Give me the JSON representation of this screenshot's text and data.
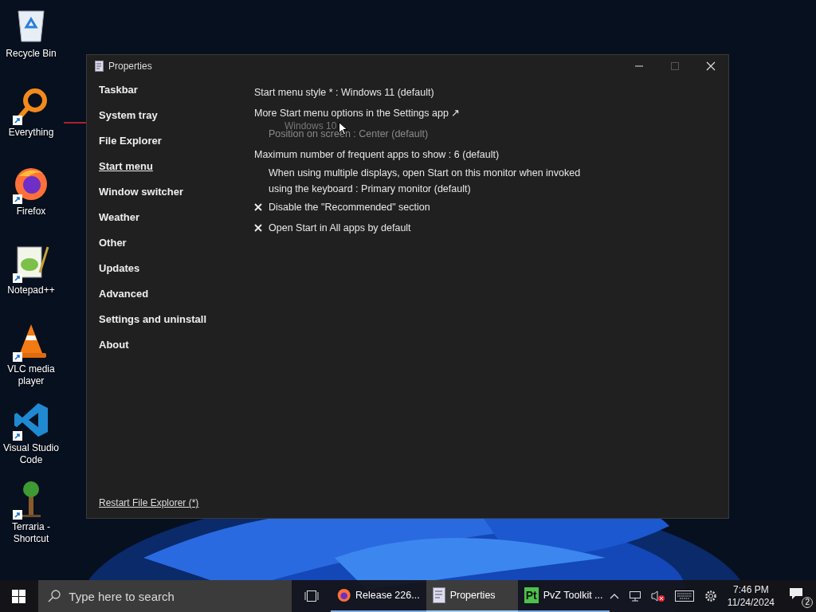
{
  "desktop_icons": [
    {
      "label": "Recycle Bin",
      "shortcut": false
    },
    {
      "label": "Everything",
      "shortcut": true
    },
    {
      "label": "Firefox",
      "shortcut": true
    },
    {
      "label": "Notepad++",
      "shortcut": true
    },
    {
      "label": "VLC media player",
      "shortcut": true
    },
    {
      "label": "Visual Studio Code",
      "shortcut": true
    },
    {
      "label": "Terraria - Shortcut",
      "shortcut": true
    }
  ],
  "window": {
    "title": "Properties",
    "maximize_disabled": true
  },
  "sidebar": {
    "items": [
      {
        "label": "Taskbar",
        "selected": false
      },
      {
        "label": "System tray",
        "selected": false
      },
      {
        "label": "File Explorer",
        "selected": false
      },
      {
        "label": "Start menu",
        "selected": true
      },
      {
        "label": "Window switcher",
        "selected": false
      },
      {
        "label": "Weather",
        "selected": false
      },
      {
        "label": "Other",
        "selected": false
      },
      {
        "label": "Updates",
        "selected": false
      },
      {
        "label": "Advanced",
        "selected": false
      },
      {
        "label": "Settings and uninstall",
        "selected": false
      },
      {
        "label": "About",
        "selected": false
      }
    ],
    "footer_link": "Restart File Explorer (*)"
  },
  "settings": [
    {
      "kind": "option",
      "text": "Start menu style * : Windows 11 (default)",
      "disabled": false
    },
    {
      "kind": "link",
      "text": "More Start menu options in the Settings app ↗",
      "disabled": false
    },
    {
      "kind": "sub",
      "text": "Position on screen : Center (default)",
      "disabled": true
    },
    {
      "kind": "option",
      "text": "Maximum number of frequent apps to show : 6 (default)",
      "disabled": false
    },
    {
      "kind": "sub",
      "text": "When using multiple displays, open Start on this monitor when invoked using the keyboard : Primary monitor (default)",
      "disabled": false
    },
    {
      "kind": "checkbox",
      "text": "Disable the \"Recommended\" section",
      "checked": false,
      "disabled": false
    },
    {
      "kind": "checkbox",
      "text": "Open Start in All apps by default",
      "checked": false,
      "disabled": false
    }
  ],
  "drag_ghost": "Windows 10",
  "taskbar": {
    "search": {
      "placeholder": "Type here to search"
    },
    "apps": [
      {
        "label": "Release 226...",
        "selected": false
      },
      {
        "label": "Properties",
        "selected": true
      },
      {
        "label": "PvZ Toolkit ...",
        "selected": false,
        "icon_text": "Pt"
      }
    ],
    "tray": {
      "volume_muted": true,
      "time": "7:46 PM",
      "date": "11/24/2024",
      "notifications": "2"
    }
  }
}
